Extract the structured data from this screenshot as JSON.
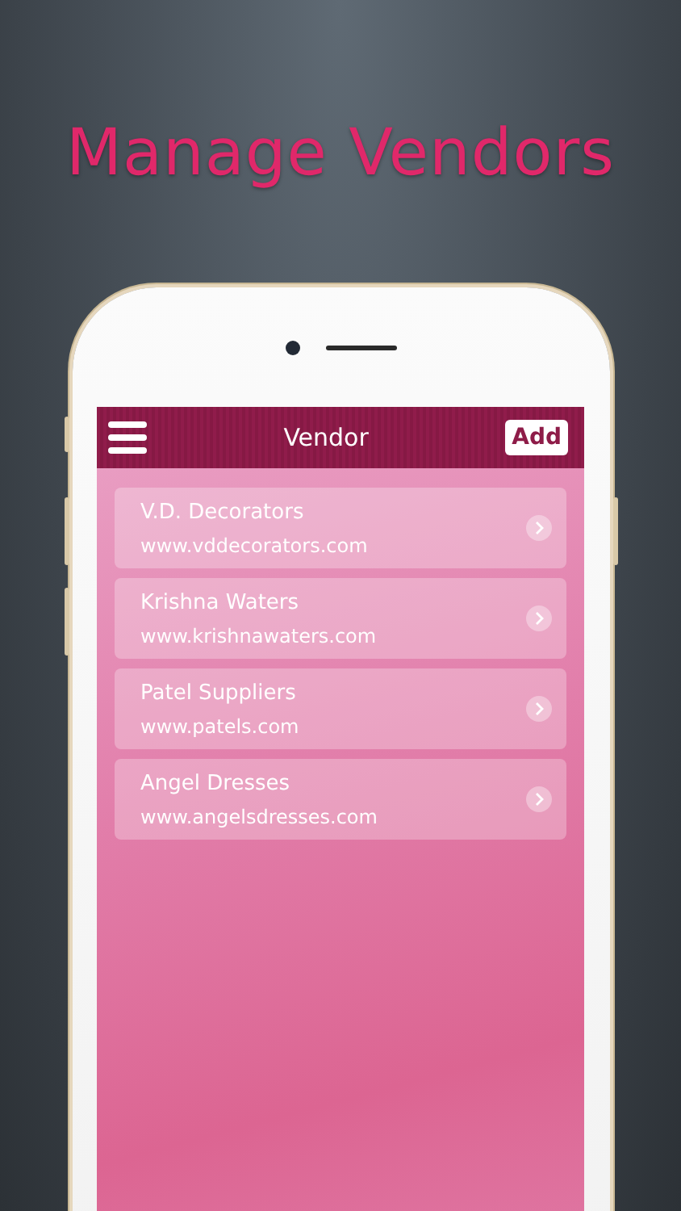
{
  "headline": "Manage Vendors",
  "app_bar": {
    "title": "Vendor",
    "action": "Add"
  },
  "vendors": [
    {
      "name": "V.D. Decorators",
      "website": "www.vddecorators.com"
    },
    {
      "name": "Krishna Waters",
      "website": "www.krishnawaters.com"
    },
    {
      "name": "Patel Suppliers",
      "website": "www.patels.com"
    },
    {
      "name": "Angel Dresses",
      "website": "www.angelsdresses.com"
    }
  ]
}
